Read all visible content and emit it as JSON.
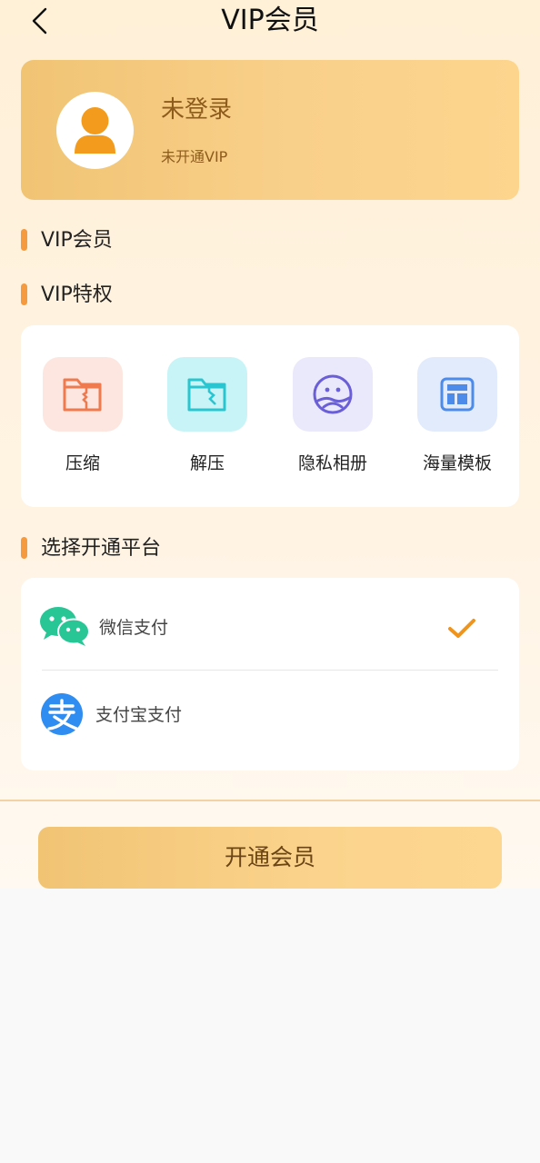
{
  "nav": {
    "title": "VIP会员",
    "back_icon": "back-arrow-icon"
  },
  "user": {
    "name": "未登录",
    "vip_status": "未开通VIP",
    "avatar_icon": "user-avatar-icon"
  },
  "sections": {
    "vip_member": "VIP会员",
    "vip_privileges": "VIP特权",
    "choose_platform": "选择开通平台"
  },
  "privileges": [
    {
      "label": "压缩",
      "icon": "compress-folder-icon",
      "bg": "#fde6df",
      "color": "#ef7a4e"
    },
    {
      "label": "解压",
      "icon": "unzip-folder-icon",
      "bg": "#c9f4f7",
      "color": "#29c6d2"
    },
    {
      "label": "隐私相册",
      "icon": "private-album-icon",
      "bg": "#eae9fb",
      "color": "#6a5fd6"
    },
    {
      "label": "海量模板",
      "icon": "template-icon",
      "bg": "#e2ebfb",
      "color": "#4d8bea"
    }
  ],
  "payments": [
    {
      "label": "微信支付",
      "icon": "wechat-icon",
      "selected": true
    },
    {
      "label": "支付宝支付",
      "icon": "alipay-icon",
      "selected": false
    }
  ],
  "check_icon": "checkmark-icon",
  "action": {
    "open_label": "开通会员"
  },
  "colors": {
    "accent": "#f59a3e",
    "gold": "#f7ca80",
    "text_brown": "#8d5b1c"
  }
}
